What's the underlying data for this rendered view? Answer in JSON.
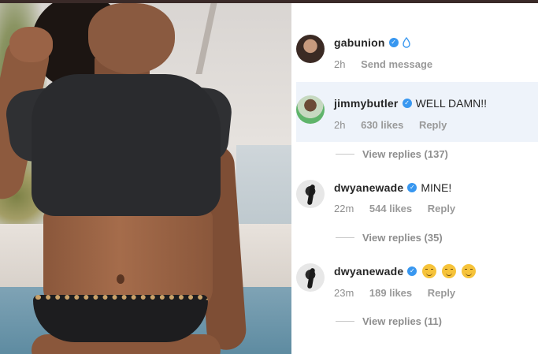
{
  "post": {
    "author": {
      "username": "gabunion",
      "time": "2h",
      "action": "Send message",
      "emoji_icon": "water-drop-icon"
    }
  },
  "comments": [
    {
      "username": "jimmybutler",
      "text": "WELL DAMN!!",
      "time": "2h",
      "likes": "630 likes",
      "reply": "Reply",
      "view_replies": "View replies (137)",
      "highlighted": true
    },
    {
      "username": "dwyanewade",
      "text": "MINE!",
      "time": "22m",
      "likes": "544 likes",
      "reply": "Reply",
      "view_replies": "View replies (35)"
    },
    {
      "username": "dwyanewade",
      "text": "",
      "emojis": [
        "relieved-face-icon",
        "relieved-face-icon",
        "relieved-face-icon"
      ],
      "time": "23m",
      "likes": "189 likes",
      "reply": "Reply",
      "view_replies": "View replies (11)"
    }
  ],
  "colors": {
    "verified": "#3897f0",
    "highlight": "#eef3fa",
    "muted": "#8e8e8e",
    "text": "#262626"
  }
}
